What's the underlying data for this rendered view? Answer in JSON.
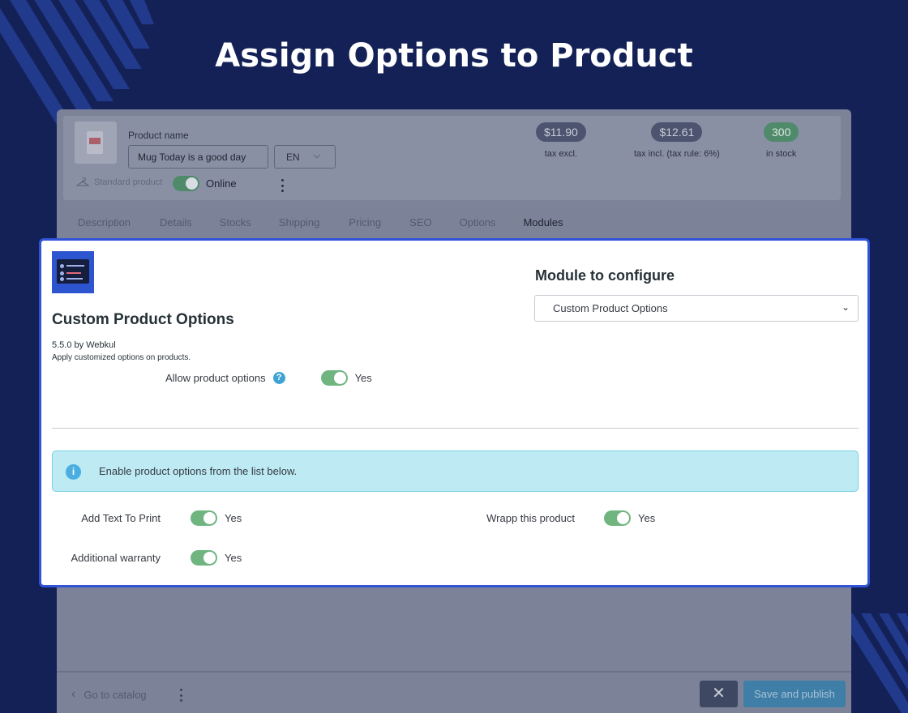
{
  "headline": "Assign Options to Product",
  "product": {
    "name_label": "Product name",
    "name_value": "Mug Today is a good day",
    "lang": "EN",
    "type": "Standard product",
    "status_label": "Online"
  },
  "prices": [
    {
      "value": "$11.90",
      "label": "tax excl."
    },
    {
      "value": "$12.61",
      "label": "tax incl. (tax rule: 6%)"
    },
    {
      "value": "300",
      "label": "in stock"
    }
  ],
  "tabs": [
    "Description",
    "Details",
    "Stocks",
    "Shipping",
    "Pricing",
    "SEO",
    "Options",
    "Modules"
  ],
  "module": {
    "title": "Custom Product Options",
    "version": "5.5.0 by Webkul",
    "description": "Apply customized options on products.",
    "allow_label": "Allow product options",
    "allow_value": "Yes",
    "configure_title": "Module to configure",
    "configure_selected": "Custom Product Options",
    "info_text": "Enable product options from the list below.",
    "options": [
      {
        "label": "Add Text To Print",
        "value": "Yes"
      },
      {
        "label": "Wrapp this product",
        "value": "Yes"
      },
      {
        "label": "Additional warranty",
        "value": "Yes"
      }
    ]
  },
  "footer": {
    "goto_label": "Go to catalog",
    "close_label": "✕",
    "save_label": "Save and publish"
  },
  "colors": {
    "background": "#132157",
    "panel_border": "#2f54d8",
    "toggle_on": "#70b580",
    "info_bg": "#bdeaf3"
  }
}
